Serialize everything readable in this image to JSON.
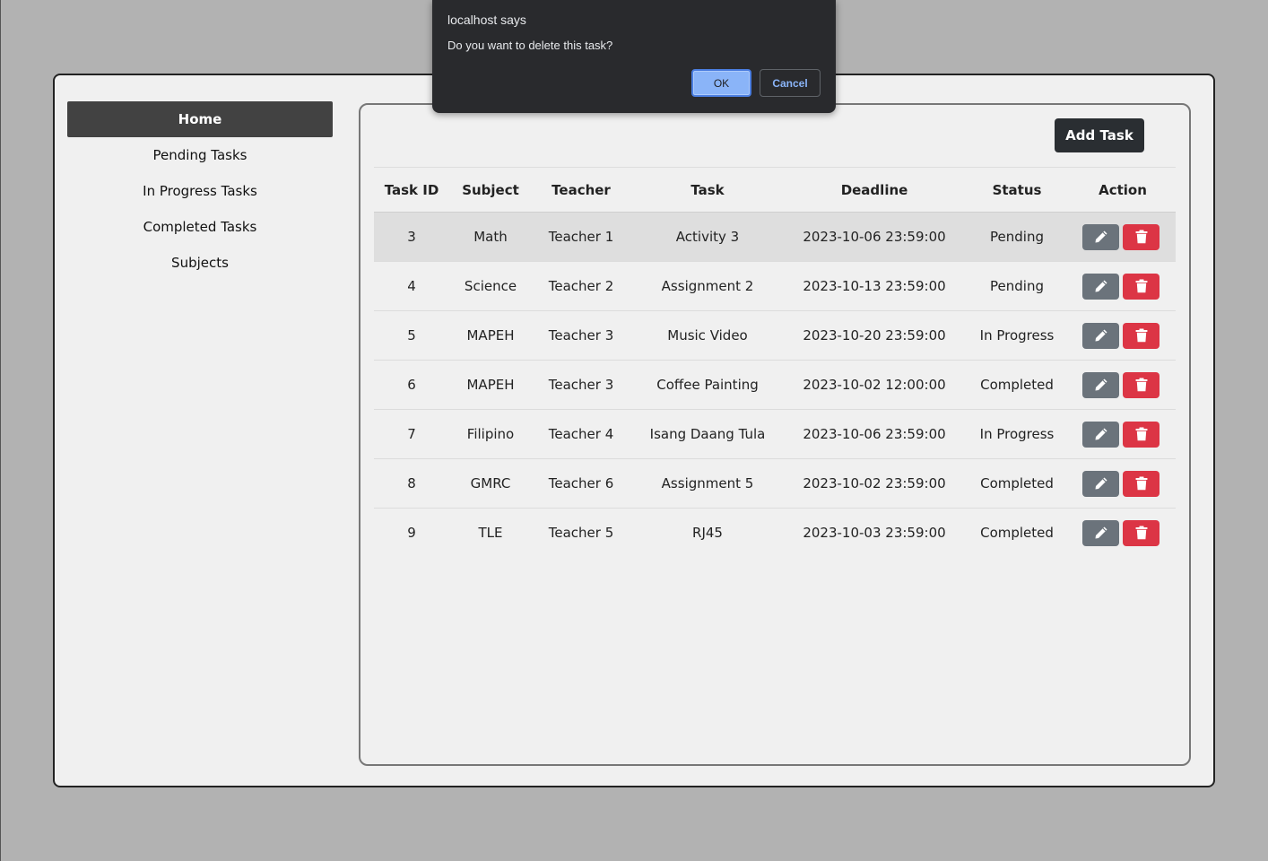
{
  "dialog": {
    "title": "localhost says",
    "message": "Do you want to delete this task?",
    "ok_label": "OK",
    "cancel_label": "Cancel"
  },
  "sidebar": {
    "items": [
      {
        "label": "Home",
        "active": true
      },
      {
        "label": "Pending Tasks",
        "active": false
      },
      {
        "label": "In Progress Tasks",
        "active": false
      },
      {
        "label": "Completed Tasks",
        "active": false
      },
      {
        "label": "Subjects",
        "active": false
      }
    ]
  },
  "toolbar": {
    "add_task_label": "Add Task"
  },
  "table": {
    "headers": [
      "Task ID",
      "Subject",
      "Teacher",
      "Task",
      "Deadline",
      "Status",
      "Action"
    ],
    "rows": [
      {
        "id": "3",
        "subject": "Math",
        "teacher": "Teacher 1",
        "task": "Activity 3",
        "deadline": "2023-10-06 23:59:00",
        "status": "Pending"
      },
      {
        "id": "4",
        "subject": "Science",
        "teacher": "Teacher 2",
        "task": "Assignment 2",
        "deadline": "2023-10-13 23:59:00",
        "status": "Pending"
      },
      {
        "id": "5",
        "subject": "MAPEH",
        "teacher": "Teacher 3",
        "task": "Music Video",
        "deadline": "2023-10-20 23:59:00",
        "status": "In Progress"
      },
      {
        "id": "6",
        "subject": "MAPEH",
        "teacher": "Teacher 3",
        "task": "Coffee Painting",
        "deadline": "2023-10-02 12:00:00",
        "status": "Completed"
      },
      {
        "id": "7",
        "subject": "Filipino",
        "teacher": "Teacher 4",
        "task": "Isang Daang Tula",
        "deadline": "2023-10-06 23:59:00",
        "status": "In Progress"
      },
      {
        "id": "8",
        "subject": "GMRC",
        "teacher": "Teacher 6",
        "task": "Assignment 5",
        "deadline": "2023-10-02 23:59:00",
        "status": "Completed"
      },
      {
        "id": "9",
        "subject": "TLE",
        "teacher": "Teacher 5",
        "task": "RJ45",
        "deadline": "2023-10-03 23:59:00",
        "status": "Completed"
      }
    ]
  },
  "colors": {
    "page_background": "#b2b2b2",
    "active_nav": "#424242",
    "add_button": "#2a2e32",
    "edit_button": "#6b737b",
    "delete_button": "#dc3545",
    "dialog_background": "#292a2d",
    "dialog_accent": "#8ab4f8"
  },
  "icons": {
    "edit": "pencil-icon",
    "delete": "trash-icon"
  }
}
